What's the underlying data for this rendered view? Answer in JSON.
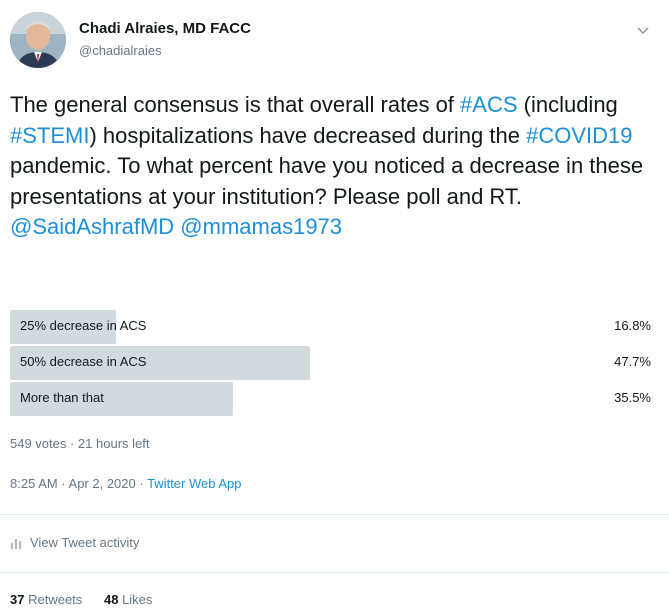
{
  "user": {
    "display_name": "Chadi Alraies, MD FACC",
    "handle": "@chadialraies"
  },
  "tweet": {
    "segments": [
      {
        "text": "The general consensus is that overall rates of ",
        "tag": false
      },
      {
        "text": "#ACS",
        "tag": true
      },
      {
        "text": " (including ",
        "tag": false
      },
      {
        "text": "#STEMI",
        "tag": true
      },
      {
        "text": ") hospitalizations have decreased during the ",
        "tag": false
      },
      {
        "text": "#COVID19",
        "tag": true
      },
      {
        "text": "  pandemic. To what percent have you noticed a decrease in these presentations at your institution? Please poll and RT. ",
        "tag": false
      },
      {
        "text": "@SaidAshrafMD",
        "tag": true
      },
      {
        "text": " ",
        "tag": false
      },
      {
        "text": "@mmamas1973",
        "tag": true
      }
    ]
  },
  "poll": {
    "options": [
      {
        "label": "25% decrease in ACS",
        "percent_text": "16.8%",
        "percent": 16.8
      },
      {
        "label": "50% decrease in ACS",
        "percent_text": "47.7%",
        "percent": 47.7
      },
      {
        "label": "More than that",
        "percent_text": "35.5%",
        "percent": 35.5
      }
    ],
    "meta": "549 votes · 21 hours left"
  },
  "timestamp": {
    "time": "8:25 AM · Apr 2, 2020 · ",
    "app": "Twitter Web App"
  },
  "activity_label": "View Tweet activity",
  "stats": {
    "retweets_count": "37",
    "retweets_label": "Retweets",
    "likes_count": "48",
    "likes_label": "Likes"
  },
  "colors": {
    "accent": "#1d8fd6",
    "poll_bar": "#d2dade"
  },
  "icons": {
    "avatar": "profile-photo",
    "caret": "chevron-down-icon",
    "activity": "bar-chart-icon"
  }
}
